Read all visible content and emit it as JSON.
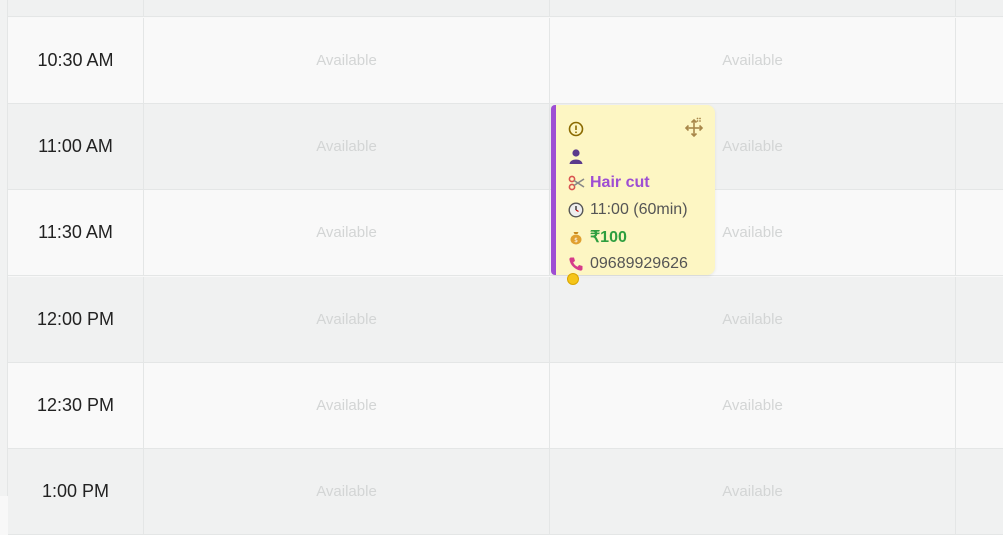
{
  "schedule": {
    "available_label": "Available",
    "rows": [
      {
        "time": ""
      },
      {
        "time": "10:30 AM"
      },
      {
        "time": "11:00 AM"
      },
      {
        "time": "11:30 AM"
      },
      {
        "time": "12:00 PM"
      },
      {
        "time": "12:30 PM"
      },
      {
        "time": "1:00 PM"
      }
    ]
  },
  "appointment": {
    "status_icon": "alert-circle-icon",
    "customer_icon": "person-icon",
    "service": "Hair cut",
    "time": "11:00 (60min)",
    "price": "₹100",
    "phone": "09689929626",
    "accent_color": "#9e4ed3",
    "background_color": "#fdf6c3"
  }
}
